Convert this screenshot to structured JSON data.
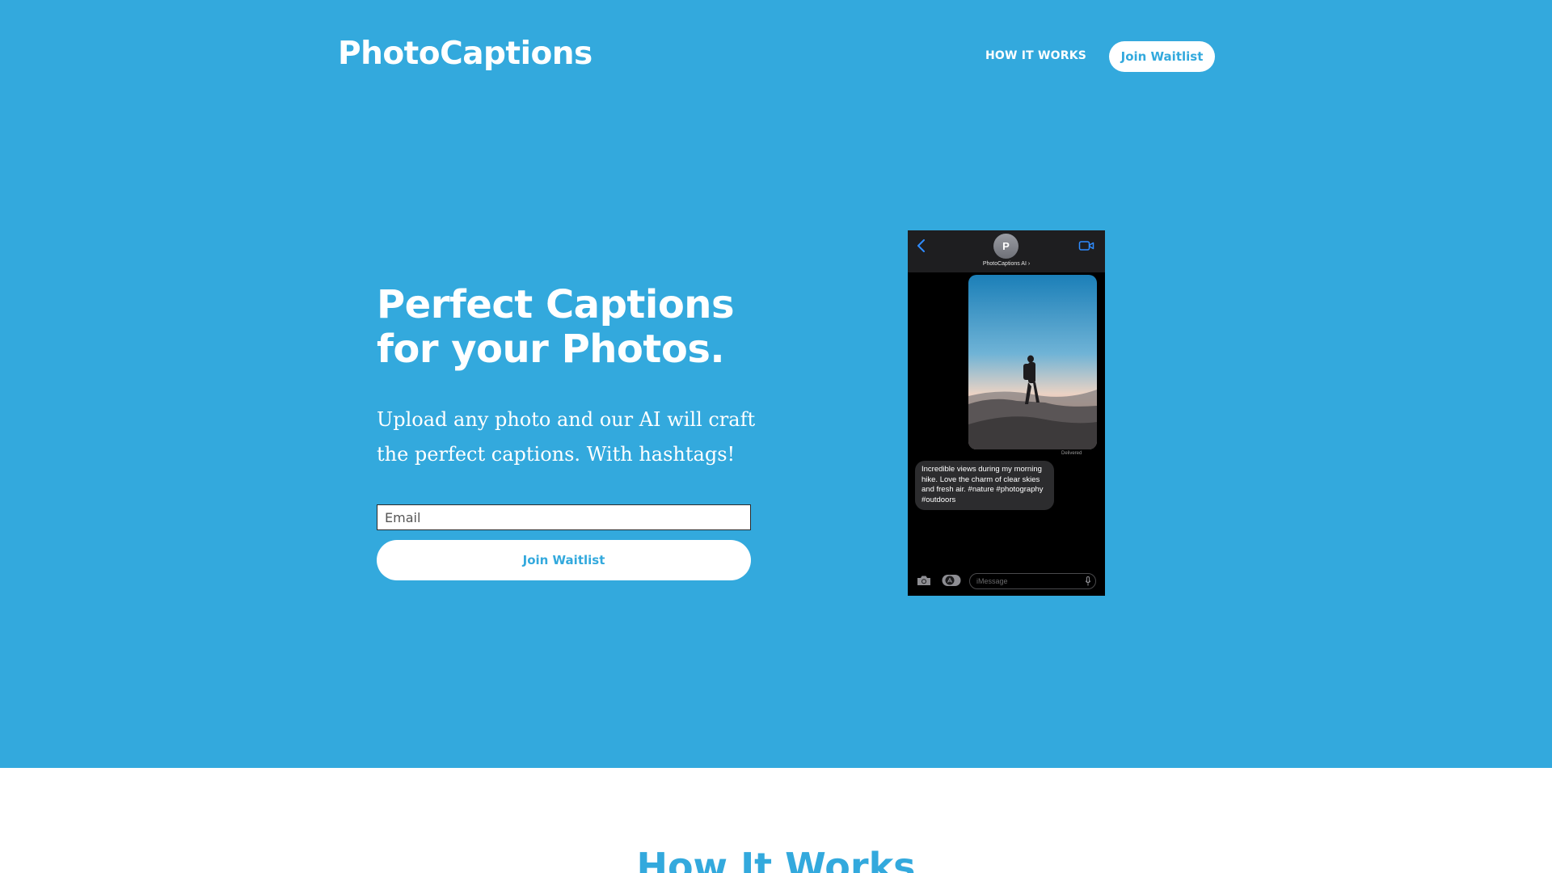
{
  "header": {
    "logo": "PhotoCaptions",
    "nav_link": "HOW IT WORKS",
    "cta_label": "Join Waitlist"
  },
  "hero": {
    "headline_line1": "Perfect Captions",
    "headline_line2": "for your Photos.",
    "subtext": "Upload any photo and our AI will craft the perfect captions. With hashtags!",
    "email_placeholder": "Email",
    "button_label": "Join Waitlist"
  },
  "phone": {
    "avatar_letter": "P",
    "contact_name": "PhotoCaptions AI ›",
    "delivered": "Delivered",
    "caption_text": "Incredible views during my morning hike. Love the charm of clear skies and fresh air. #nature #photography #outdoors",
    "imessage_placeholder": "iMessage"
  },
  "section": {
    "how_it_works_title": "How It Works"
  },
  "colors": {
    "brand_blue": "#33a9dd",
    "white": "#ffffff",
    "phone_black": "#000000"
  },
  "icons": [
    "chevron-left-icon",
    "video-camera-icon",
    "camera-icon",
    "app-store-icon",
    "microphone-icon"
  ]
}
